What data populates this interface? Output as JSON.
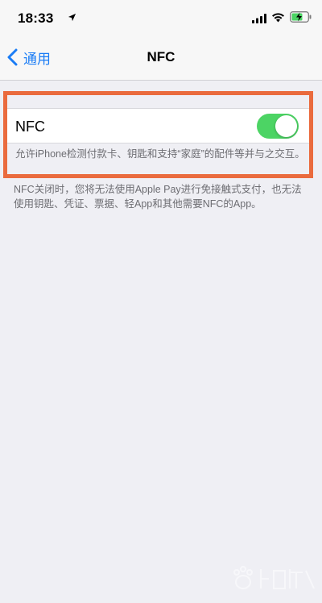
{
  "status_bar": {
    "time": "18:33",
    "icons": [
      "location-arrow-icon",
      "cellular-signal-icon",
      "wifi-icon",
      "battery-charging-icon"
    ]
  },
  "nav": {
    "back_label": "通用",
    "title": "NFC"
  },
  "nfc_setting": {
    "label": "NFC",
    "enabled": true,
    "footer": "允许iPhone检测付款卡、钥匙和支持“家庭”的配件等并与之交互。"
  },
  "note": "NFC关闭时，您将无法使用Apple Pay进行免接触式支付，也无法使用钥匙、凭证、票据、轻App和其他需要NFC的App。",
  "colors": {
    "accent": "#1a7cf5",
    "toggle_on": "#4cd464",
    "highlight": "#ea6b3e",
    "background": "#efeff4"
  }
}
